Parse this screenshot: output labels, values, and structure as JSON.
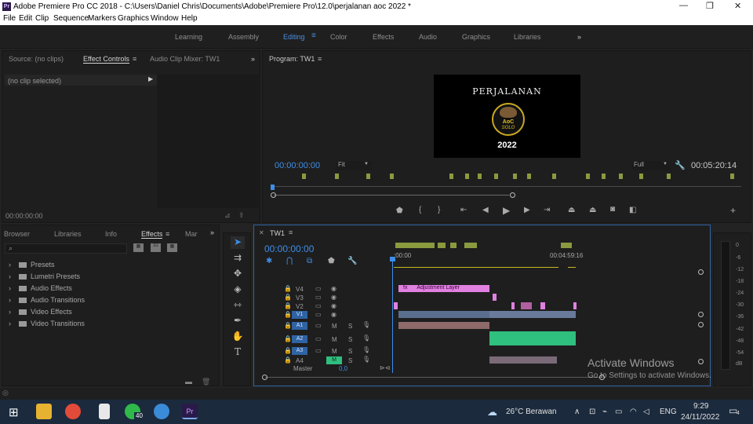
{
  "window": {
    "title": "Adobe Premiere Pro CC 2018 - C:\\Users\\Daniel Chris\\Documents\\Adobe\\Premiere Pro\\12.0\\perjalanan aoc 2022 *",
    "app_icon": "Pr",
    "controls": [
      "—",
      "❐",
      "✕"
    ]
  },
  "menu": [
    "File",
    "Edit",
    "Clip",
    "Sequence",
    "Markers",
    "Graphics",
    "Window",
    "Help"
  ],
  "workspaces": {
    "items": [
      "Learning",
      "Assembly",
      "Editing",
      "Color",
      "Effects",
      "Audio",
      "Graphics",
      "Libraries"
    ],
    "active": "Editing",
    "more": "»"
  },
  "source_panel": {
    "tabs": [
      "Source: (no clips)",
      "Effect Controls",
      "Audio Clip Mixer: TW1"
    ],
    "active_tab": "Effect Controls",
    "no_clip": "(no clip selected)",
    "timecode": "00:00:00:00"
  },
  "program_panel": {
    "title": "Program: TW1",
    "timecode": "00:00:00:00",
    "fit": "Fit",
    "resolution": "Full",
    "duration": "00:05:20:14",
    "preview": {
      "heading": "PERJALANAN",
      "logo_line1": "AoC",
      "logo_line2": "SOLO",
      "year": "2022"
    }
  },
  "effects_panel": {
    "tabs": [
      "Browser",
      "Libraries",
      "Info",
      "Effects",
      "Mar"
    ],
    "active_tab": "Effects",
    "search_placeholder": "",
    "folders": [
      "Presets",
      "Lumetri Presets",
      "Audio Effects",
      "Audio Transitions",
      "Video Effects",
      "Video Transitions"
    ]
  },
  "timeline": {
    "tab": "TW1",
    "timecode": "00:00:00:00",
    "ruler_start": ":00:00",
    "ruler_end": "00:04:59:16",
    "video_tracks": [
      "V4",
      "V3",
      "V2",
      "V1"
    ],
    "audio_tracks": [
      "A1",
      "A2",
      "A3",
      "A4"
    ],
    "master_label": "Master",
    "master_value": "0,0",
    "adjustment_layer": "Adjustment Layer",
    "mute_label": "M",
    "solo_label": "S"
  },
  "meter_scale": [
    "0",
    "-6",
    "-12",
    "-18",
    "-24",
    "-30",
    "-36",
    "-42",
    "-48",
    "-54",
    "dB"
  ],
  "watermark": {
    "title": "Activate Windows",
    "subtitle": "Go to Settings to activate Windows."
  },
  "taskbar": {
    "weather": "26°C  Berawan",
    "language": "ENG",
    "time": "9:29",
    "date": "24/11/2022",
    "notifications": "4",
    "whatsapp_badge": "40"
  },
  "colors": {
    "accent_blue": "#3d8ee8",
    "adjustment_clip": "#e080e0",
    "audio_clip_green": "#2fbf7e",
    "marker_olive": "#8a9a3e"
  }
}
